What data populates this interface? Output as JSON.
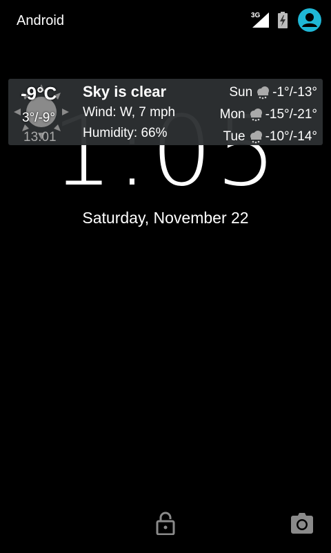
{
  "status_bar": {
    "carrier": "Android",
    "network_type": "3G",
    "accent_color": "#1fb7d6"
  },
  "lock_screen": {
    "clock": "1:05",
    "date": "Saturday, November 22"
  },
  "weather": {
    "current_temp": "-9°C",
    "hi_lo": "3°/-9°",
    "updated_time": "13:01",
    "condition": "Sky is clear",
    "wind": "Wind: W, 7 mph",
    "humidity": "Humidity: 66%",
    "forecast": [
      {
        "day": "Sun",
        "icon": "snow-cloud-icon",
        "temps": "-1°/-13°"
      },
      {
        "day": "Mon",
        "icon": "snow-cloud-icon",
        "temps": "-15°/-21°"
      },
      {
        "day": "Tue",
        "icon": "snow-cloud-icon",
        "temps": "-10°/-14°"
      }
    ]
  },
  "bottom_actions": {
    "unlock_icon": "lock-icon",
    "camera_icon": "camera-icon"
  }
}
